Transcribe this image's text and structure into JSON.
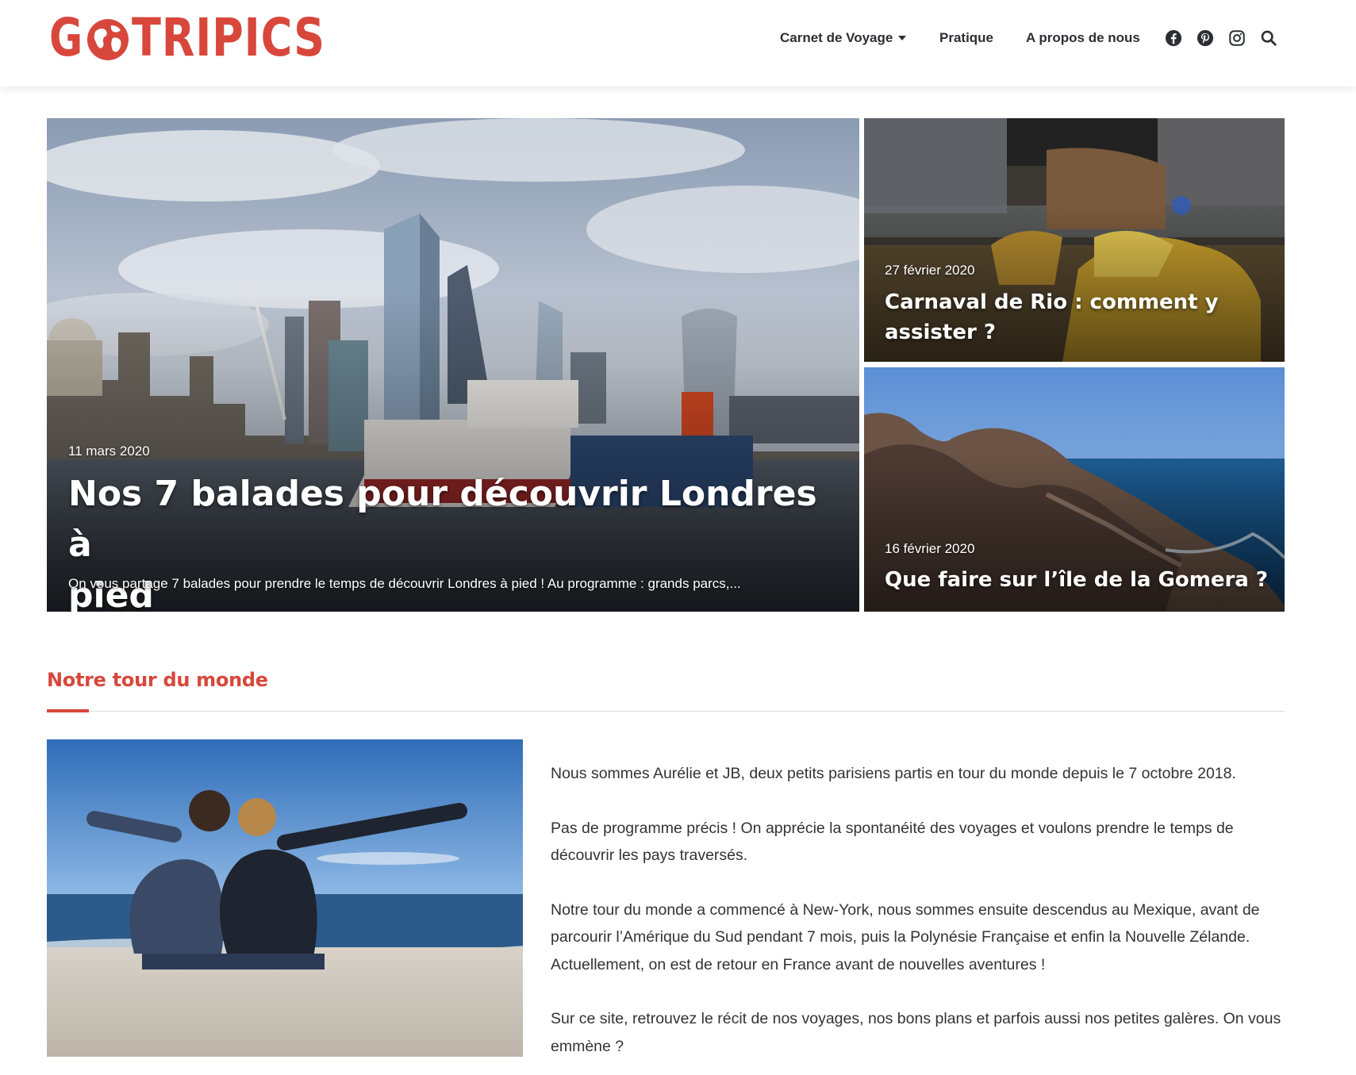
{
  "header": {
    "logo": {
      "text_left": "G",
      "text_right": "TRIPICS",
      "icon": "globe-icon"
    },
    "nav": [
      {
        "label": "Carnet de Voyage",
        "has_dropdown": true
      },
      {
        "label": "Pratique",
        "has_dropdown": false
      },
      {
        "label": "A propos de nous",
        "has_dropdown": false
      }
    ],
    "social_icons": [
      "facebook-icon",
      "pinterest-icon",
      "instagram-icon"
    ],
    "search_icon": "search-icon"
  },
  "hero": {
    "main": {
      "date": "11 mars 2020",
      "title_line1": "Nos 7 balades pour découvrir Londres à",
      "title_line2": "pied",
      "excerpt": "On vous partage 7 balades pour prendre le temps de découvrir Londres à pied ! Au programme : grands parcs,..."
    },
    "side": [
      {
        "date": "27 février 2020",
        "title_line1": "Carnaval de Rio : comment y",
        "title_line2": "assister ?"
      },
      {
        "date": "16 février 2020",
        "title_line1": "Que faire sur l’île de la Gomera ?"
      }
    ]
  },
  "section": {
    "title": "Notre tour du monde",
    "paragraphs": [
      "Nous sommes Aurélie et JB, deux petits parisiens partis en tour du monde depuis le 7 octobre 2018.",
      "Pas de programme précis ! On apprécie la spontanéité des voyages et voulons prendre le temps de découvrir les pays traversés.",
      "Notre tour du monde a commencé à New-York, nous sommes ensuite descendus au Mexique, avant de parcourir l’Amérique du Sud pendant 7 mois, puis la Polynésie Française et enfin la Nouvelle Zélande. Actuellement, on est de retour en France avant de nouvelles aventures !",
      "Sur ce site, retrouvez le récit de nos voyages,  nos bons plans et parfois aussi nos petites galères. On vous emmène ?"
    ]
  },
  "colors": {
    "accent": "#d8473b",
    "text": "#2c2f34"
  }
}
